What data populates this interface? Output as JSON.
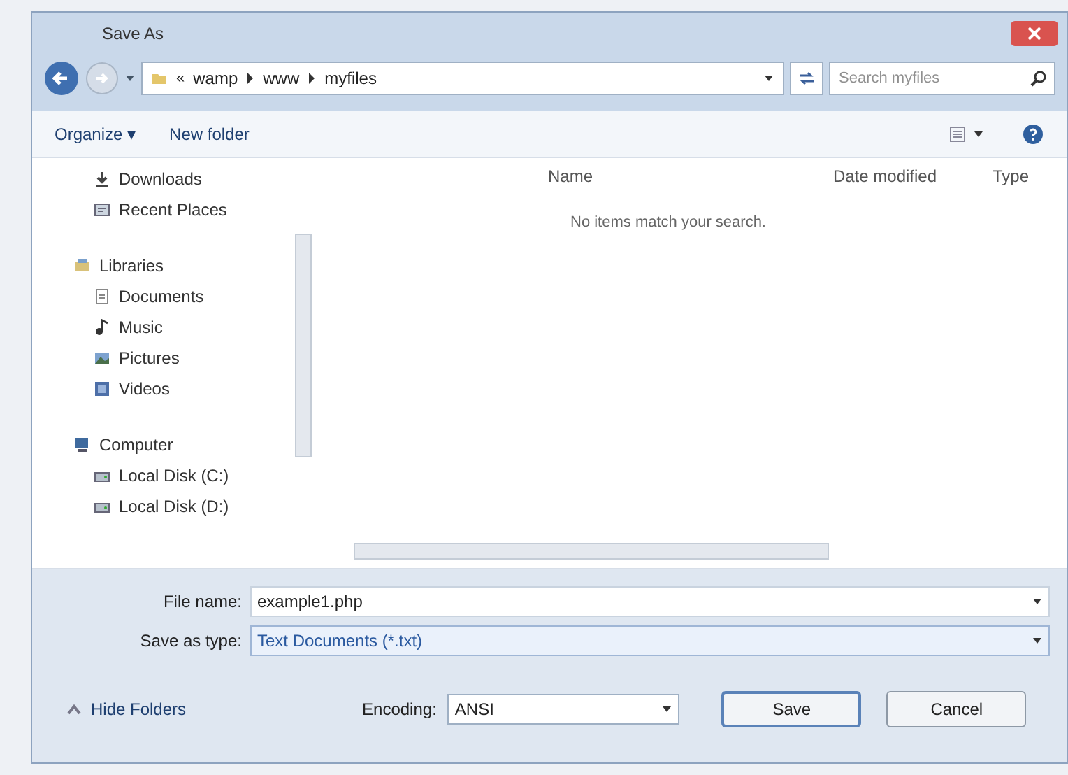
{
  "window": {
    "title": "Save As"
  },
  "address_bar": {
    "prefix": "«",
    "path": [
      "wamp",
      "www",
      "myfiles"
    ],
    "search": {
      "placeholder": "Search myfiles"
    }
  },
  "toolbar": {
    "organize": "Organize ▾",
    "new_folder": "New folder"
  },
  "nav": [
    {
      "label": "Downloads",
      "kind": "download"
    },
    {
      "label": "Recent Places",
      "kind": "recent"
    },
    {
      "label": "Libraries",
      "kind": "library",
      "children": [
        {
          "label": "Documents",
          "kind": "document"
        },
        {
          "label": "Music",
          "kind": "music"
        },
        {
          "label": "Pictures",
          "kind": "pictures"
        },
        {
          "label": "Videos",
          "kind": "videos"
        }
      ]
    },
    {
      "label": "Computer",
      "kind": "computer",
      "children": [
        {
          "label": "Local Disk (C:)",
          "kind": "disk"
        },
        {
          "label": "Local Disk (D:)",
          "kind": "disk"
        }
      ]
    }
  ],
  "columns": [
    "Name",
    "Date modified",
    "Type"
  ],
  "empty_message": "No items match your search.",
  "file_name": {
    "label": "File name:",
    "value": "example1.php"
  },
  "save_as_type": {
    "label": "Save as type:",
    "value": "Text Documents (*.txt)"
  },
  "hide_folders": "Hide Folders",
  "encoding": {
    "label": "Encoding:",
    "value": "ANSI"
  },
  "buttons": [
    "Save",
    "Cancel"
  ]
}
